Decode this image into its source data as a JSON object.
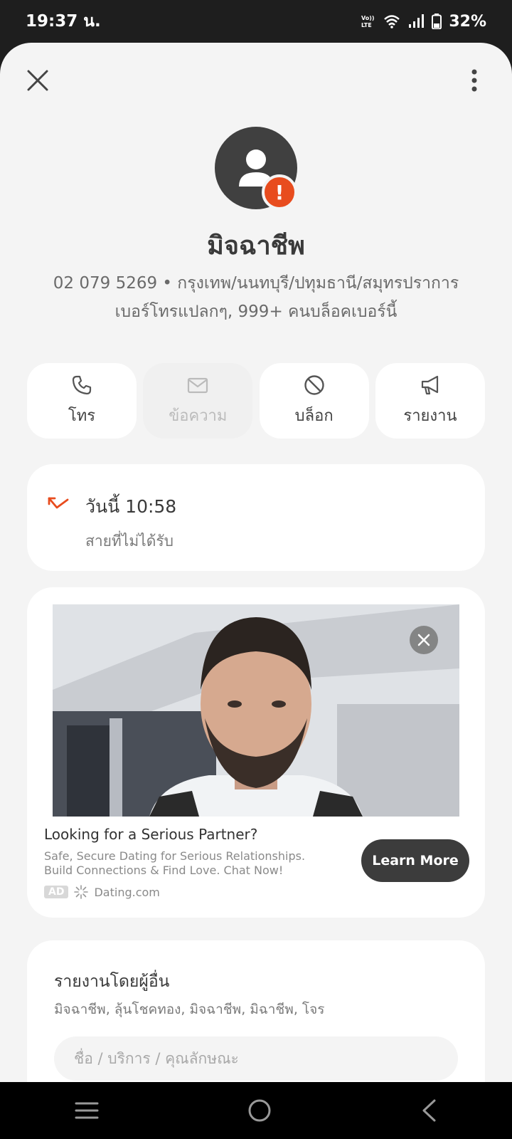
{
  "status": {
    "time": "19:37 น.",
    "battery": "32%",
    "volte": "VoLTE"
  },
  "caller": {
    "name": "มิจฉาชีพ",
    "number_line": "02 079 5269 • กรุงเทพ/นนทบุรี/ปทุมธานี/สมุทรปราการ",
    "description": "เบอร์โทรแปลกๆ, 999+ คนบล็อคเบอร์นี้"
  },
  "actions": [
    {
      "label": "โทร",
      "icon": "phone-icon",
      "enabled": true
    },
    {
      "label": "ข้อความ",
      "icon": "mail-icon",
      "enabled": false
    },
    {
      "label": "บล็อก",
      "icon": "block-icon",
      "enabled": true
    },
    {
      "label": "รายงาน",
      "icon": "megaphone-icon",
      "enabled": true
    }
  ],
  "call_log": {
    "time": "วันนี้ 10:58",
    "status": "สายที่ไม่ได้รับ",
    "icon": "missed-call-icon"
  },
  "ad": {
    "title": "Looking for a Serious Partner?",
    "description": "Safe, Secure Dating for Serious Relationships. Build Connections & Find Love. Chat Now!",
    "badge": "AD",
    "advertiser": "Dating.com",
    "cta": "Learn More"
  },
  "reports": {
    "title": "รายงานโดยผู้อื่น",
    "tags": "มิจฉาชีพ, ลุ้นโชคทอง, มิจฉาชีพ, มิฉาชีพ, โจร",
    "input_placeholder": "ชื่อ / บริการ / คุณลักษณะ"
  },
  "colors": {
    "accent": "#e84c1e",
    "avatar": "#404040",
    "background": "#f4f4f4"
  }
}
